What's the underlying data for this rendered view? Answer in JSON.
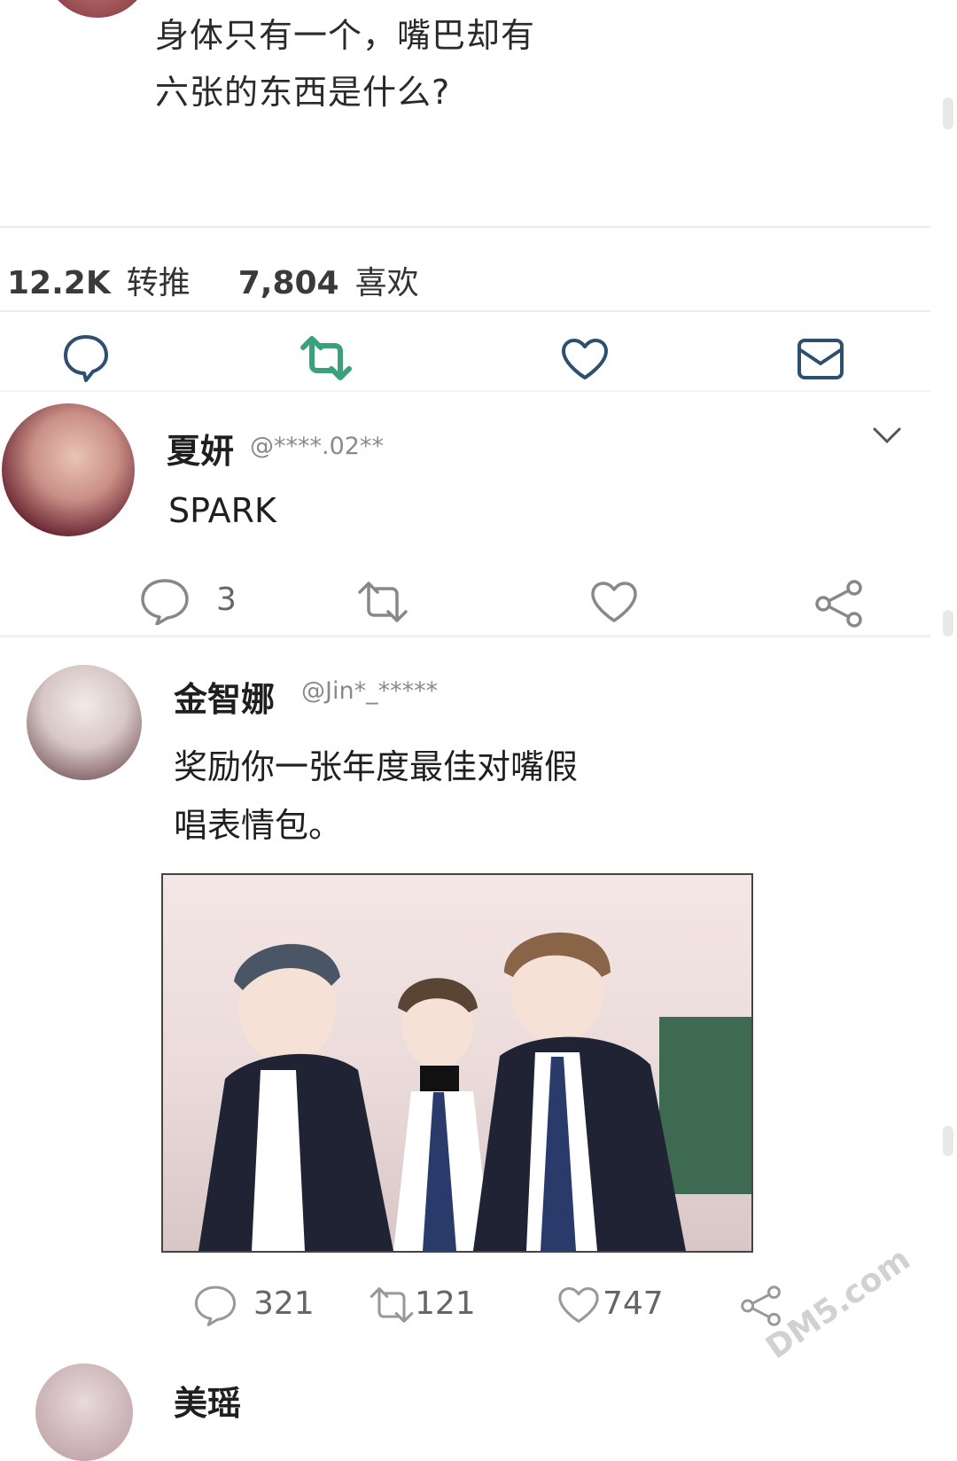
{
  "top_tweet": {
    "text_line1": "身体只有一个，嘴巴却有",
    "text_line2": "六张的东西是什么?",
    "retweets_count": "12.2K",
    "retweets_label": "转推",
    "likes_count": "7,804",
    "likes_label": "喜欢"
  },
  "actions_bar": {
    "icons": [
      "reply-icon",
      "retweet-icon",
      "like-icon",
      "message-icon"
    ],
    "retweet_color": "#3aa17a"
  },
  "replies": [
    {
      "username": "夏妍",
      "handle": "@****.02**",
      "text": "SPARK",
      "reply_count": "3",
      "retweet_count": "",
      "like_count": ""
    },
    {
      "username": "金智娜",
      "handle": "@Jin*_*****",
      "text_line1": "奖励你一张年度最佳对嘴假",
      "text_line2": "唱表情包。",
      "reply_count": "321",
      "retweet_count": "121",
      "like_count": "747"
    }
  ],
  "next_reply_partial": {
    "username": "美瑶"
  },
  "watermark": "DM5.com"
}
